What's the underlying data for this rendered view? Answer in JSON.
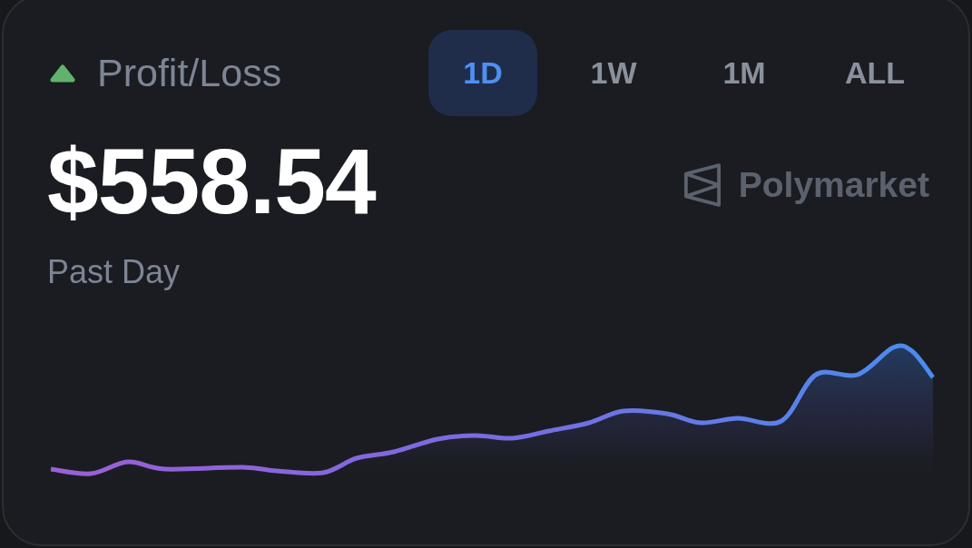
{
  "header": {
    "rising": true,
    "title": "Profit/Loss"
  },
  "tabs": [
    {
      "label": "1D",
      "selected": true
    },
    {
      "label": "1W",
      "selected": false
    },
    {
      "label": "1M",
      "selected": false
    },
    {
      "label": "ALL",
      "selected": false
    }
  ],
  "amount": "$558.54",
  "brand": {
    "name": "Polymarket"
  },
  "caption": "Past Day"
}
